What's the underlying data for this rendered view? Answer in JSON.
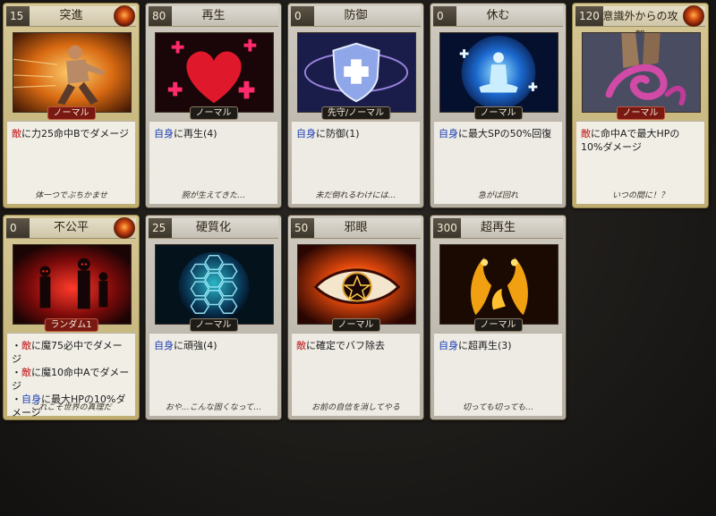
{
  "cards": [
    {
      "cost": "15",
      "name": "突進",
      "rarity": "ノーマル",
      "style": "gold",
      "tag_style": "red",
      "effect": [
        {
          "parts": [
            {
              "t": "敵",
              "c": "rd"
            },
            {
              "t": "に力25命中Bでダメージ",
              "c": ""
            }
          ]
        }
      ],
      "flavor": "体一つでぶちかませ",
      "icon": "charging-man-icon"
    },
    {
      "cost": "80",
      "name": "再生",
      "rarity": "ノーマル",
      "style": "grey",
      "tag_style": "",
      "effect": [
        {
          "parts": [
            {
              "t": "自身",
              "c": "bl"
            },
            {
              "t": "に再生(4)",
              "c": ""
            }
          ]
        }
      ],
      "flavor": "腕が生えてきた…",
      "icon": "heart-cross-icon"
    },
    {
      "cost": "0",
      "name": "防御",
      "rarity": "先守/ノーマル",
      "style": "grey",
      "tag_style": "",
      "effect": [
        {
          "parts": [
            {
              "t": "自身",
              "c": "bl"
            },
            {
              "t": "に防御(1)",
              "c": ""
            }
          ]
        }
      ],
      "flavor": "未だ倒れるわけには…",
      "icon": "shield-icon"
    },
    {
      "cost": "0",
      "name": "休む",
      "rarity": "ノーマル",
      "style": "grey",
      "tag_style": "",
      "effect": [
        {
          "parts": [
            {
              "t": "自身",
              "c": "bl"
            },
            {
              "t": "に最大SPの50%回復",
              "c": ""
            }
          ]
        }
      ],
      "flavor": "急がば回れ",
      "icon": "meditation-icon"
    },
    {
      "cost": "120",
      "name": "意識外からの攻撃",
      "rarity": "ノーマル",
      "style": "gold",
      "tag_style": "red",
      "effect": [
        {
          "parts": [
            {
              "t": "敵",
              "c": "rd"
            },
            {
              "t": "に命中Aで最大HPの",
              "c": ""
            }
          ]
        },
        {
          "parts": [
            {
              "t": "10%ダメージ",
              "c": ""
            }
          ]
        }
      ],
      "flavor": "いつの間に！？",
      "icon": "tentacle-icon"
    },
    {
      "cost": "0",
      "name": "不公平",
      "rarity": "ランダム1",
      "style": "gold",
      "tag_style": "red",
      "effect": [
        {
          "parts": [
            {
              "t": "・",
              "c": ""
            },
            {
              "t": "敵",
              "c": "rd"
            },
            {
              "t": "に魔75必中でダメージ",
              "c": ""
            }
          ]
        },
        {
          "parts": [
            {
              "t": "・",
              "c": ""
            },
            {
              "t": "敵",
              "c": "rd"
            },
            {
              "t": "に魔10命中Aでダメージ",
              "c": ""
            }
          ]
        },
        {
          "parts": [
            {
              "t": "・",
              "c": ""
            },
            {
              "t": "自身",
              "c": "bl"
            },
            {
              "t": "に最大HPの10%ダ",
              "c": ""
            }
          ]
        },
        {
          "parts": [
            {
              "t": "メージ",
              "c": ""
            }
          ]
        }
      ],
      "flavor": "これこそ世界の真理だ",
      "icon": "shadow-figures-icon"
    },
    {
      "cost": "25",
      "name": "硬質化",
      "rarity": "ノーマル",
      "style": "grey",
      "tag_style": "",
      "effect": [
        {
          "parts": [
            {
              "t": "自身",
              "c": "bl"
            },
            {
              "t": "に頑強(4)",
              "c": ""
            }
          ]
        }
      ],
      "flavor": "おや…こんな固くなって…",
      "icon": "hex-sphere-icon"
    },
    {
      "cost": "50",
      "name": "邪眼",
      "rarity": "ノーマル",
      "style": "grey",
      "tag_style": "",
      "effect": [
        {
          "parts": [
            {
              "t": "敵",
              "c": "rd"
            },
            {
              "t": "に確定でバフ除去",
              "c": ""
            }
          ]
        }
      ],
      "flavor": "お前の自信を消してやる",
      "icon": "evil-eye-icon"
    },
    {
      "cost": "300",
      "name": "超再生",
      "rarity": "ノーマル",
      "style": "grey",
      "tag_style": "",
      "effect": [
        {
          "parts": [
            {
              "t": "自身",
              "c": "bl"
            },
            {
              "t": "に超再生(3)",
              "c": ""
            }
          ]
        }
      ],
      "flavor": "切っても切っても…",
      "icon": "phoenix-icon"
    }
  ]
}
